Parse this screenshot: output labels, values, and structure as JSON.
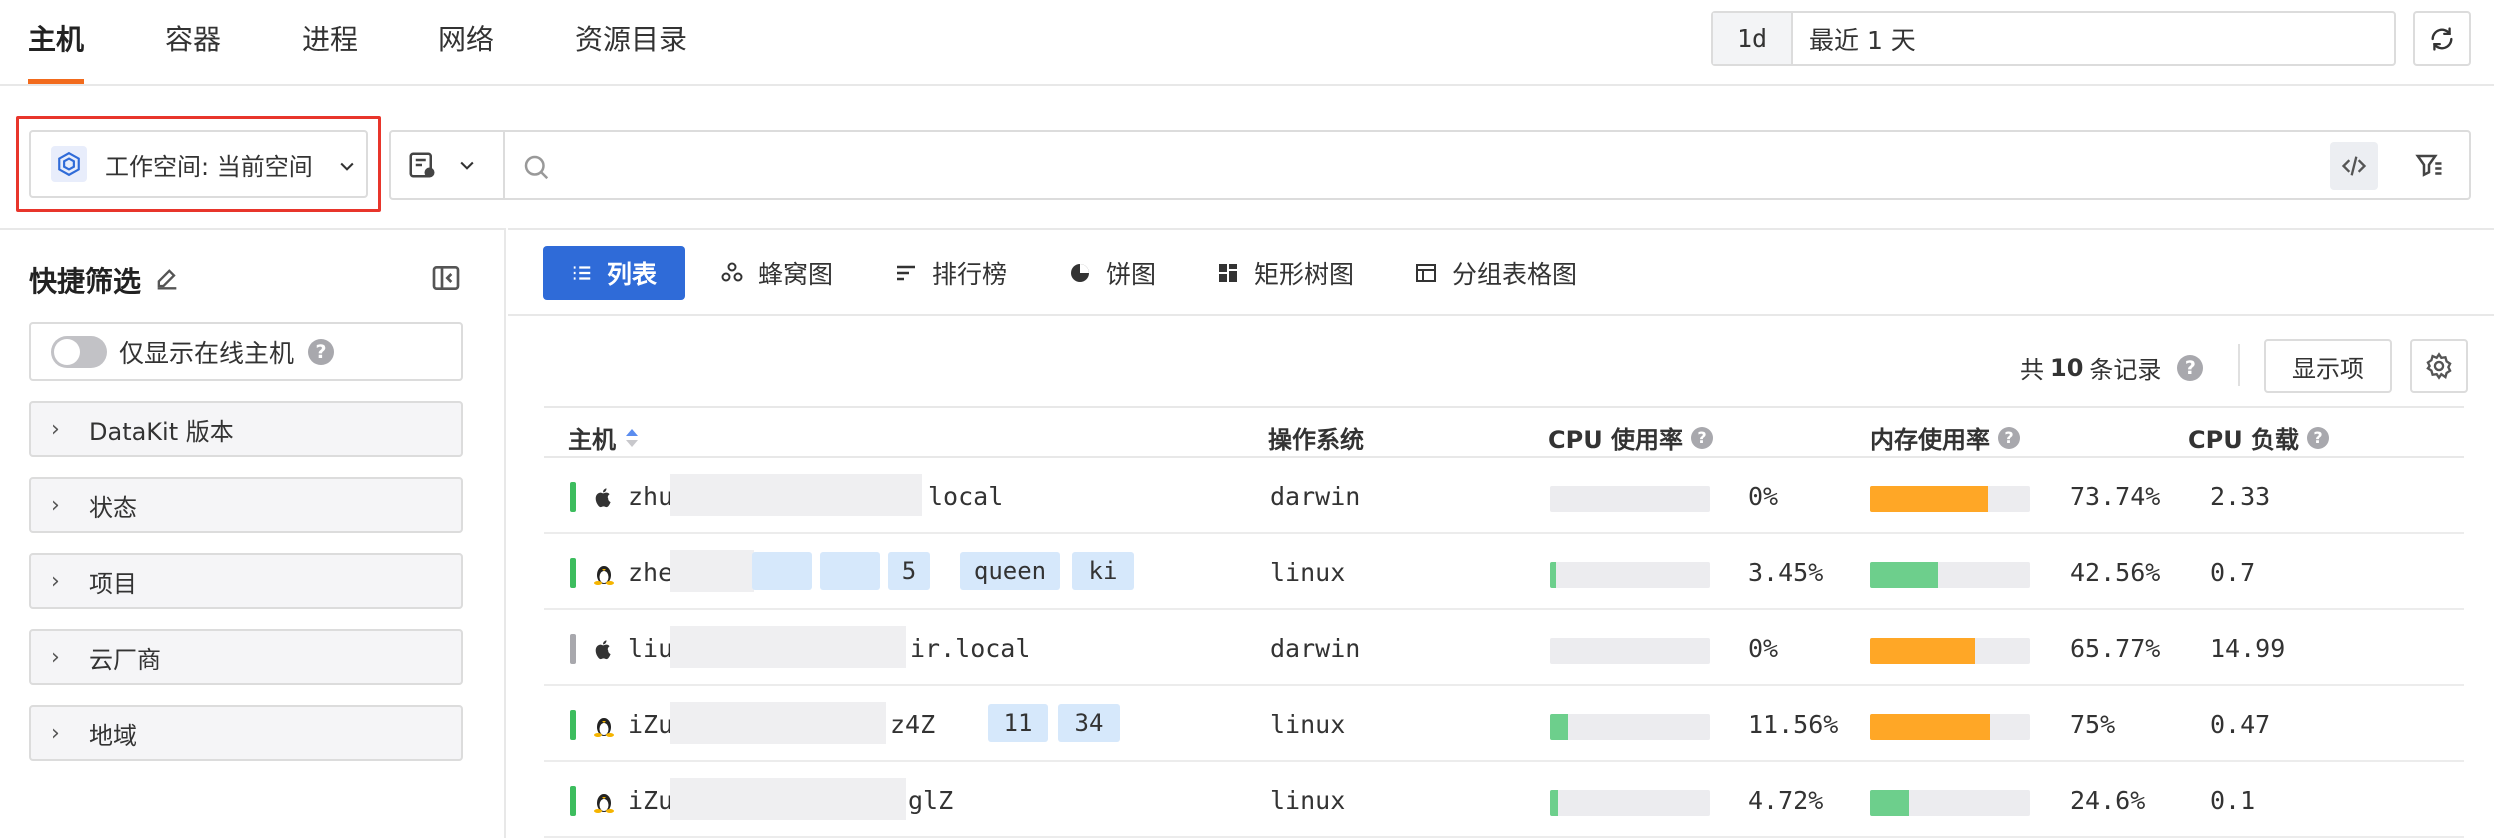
{
  "nav": {
    "tabs": [
      {
        "label": "主机",
        "active": true
      },
      {
        "label": "容器",
        "active": false
      },
      {
        "label": "进程",
        "active": false
      },
      {
        "label": "网络",
        "active": false
      },
      {
        "label": "资源目录",
        "active": false
      }
    ],
    "time_badge": "1d",
    "time_range": "最近 1 天"
  },
  "filter": {
    "workspace_label": "工作空间: 当前空间",
    "search_placeholder": ""
  },
  "sidebar": {
    "title": "快捷筛选",
    "online_only_label": "仅显示在线主机",
    "online_only_enabled": false,
    "groups": [
      "DataKit 版本",
      "状态",
      "项目",
      "云厂商",
      "地域"
    ]
  },
  "views": {
    "tabs": [
      "列表",
      "蜂窝图",
      "排行榜",
      "饼图",
      "矩形树图",
      "分组表格图"
    ],
    "active": "列表"
  },
  "summary": {
    "prefix": "共",
    "count": "10",
    "suffix": "条记录",
    "display_button": "显示项"
  },
  "table": {
    "columns": [
      "主机",
      "操作系统",
      "CPU 使用率",
      "内存使用率",
      "CPU 负载"
    ],
    "rows": [
      {
        "status": "online",
        "os_icon": "apple-icon",
        "host_prefix": "zhu",
        "host_suffix": "local",
        "tags": [],
        "os": "darwin",
        "cpu": "0%",
        "cpu_value": 0,
        "mem": "73.74%",
        "mem_value": 73.74,
        "load": "2.33"
      },
      {
        "status": "online",
        "os_icon": "linux-icon",
        "host_prefix": "zhe",
        "host_suffix": "",
        "tags": [
          "",
          "",
          "5",
          "queen",
          "ki"
        ],
        "os": "linux",
        "cpu": "3.45%",
        "cpu_value": 3.45,
        "mem": "42.56%",
        "mem_value": 42.56,
        "load": "0.7"
      },
      {
        "status": "offline",
        "os_icon": "apple-icon",
        "host_prefix": "liu",
        "host_suffix": "ir.local",
        "tags": [],
        "os": "darwin",
        "cpu": "0%",
        "cpu_value": 0,
        "mem": "65.77%",
        "mem_value": 65.77,
        "load": "14.99"
      },
      {
        "status": "online",
        "os_icon": "linux-icon",
        "host_prefix": "iZu",
        "host_suffix": "z4Z",
        "tags": [
          "11",
          "34"
        ],
        "os": "linux",
        "cpu": "11.56%",
        "cpu_value": 11.56,
        "mem": "75%",
        "mem_value": 75,
        "load": "0.47"
      },
      {
        "status": "online",
        "os_icon": "linux-icon",
        "host_prefix": "iZu",
        "host_suffix": "glZ",
        "tags": [],
        "os": "linux",
        "cpu": "4.72%",
        "cpu_value": 4.72,
        "mem": "24.6%",
        "mem_value": 24.6,
        "load": "0.1"
      }
    ]
  },
  "colors": {
    "accent_orange": "#f26b1d",
    "primary_blue": "#2f6bd8",
    "status_online": "#3dbd5e",
    "status_offline": "#a8a8ad",
    "bar_green": "#6dcf8c",
    "bar_orange": "#ffa726",
    "highlight_red": "#e8352b"
  }
}
